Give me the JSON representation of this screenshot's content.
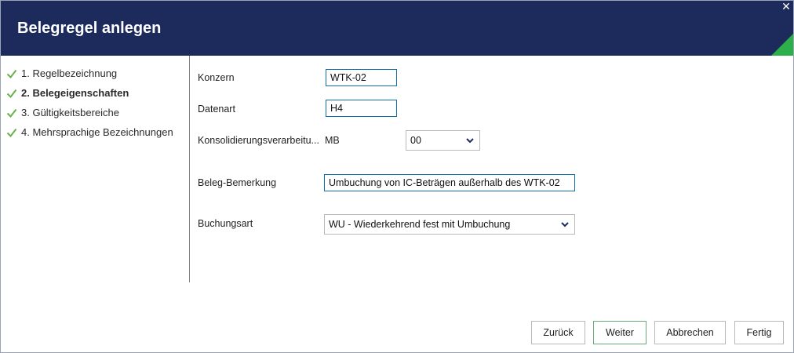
{
  "dialog": {
    "title": "Belegregel anlegen",
    "close_symbol": "✕"
  },
  "steps": [
    {
      "label": "1. Regelbezeichnung",
      "done": true,
      "active": false
    },
    {
      "label": "2. Belegeigenschaften",
      "done": true,
      "active": true
    },
    {
      "label": "3. Gültigkeitsbereiche",
      "done": true,
      "active": false
    },
    {
      "label": "4. Mehrsprachige Bezeichnungen",
      "done": true,
      "active": false
    }
  ],
  "form": {
    "konzern": {
      "label": "Konzern",
      "value": "WTK-02"
    },
    "datenart": {
      "label": "Datenart",
      "value": "H4"
    },
    "konsolidierung": {
      "label": "Konsolidierungsverarbeitu...",
      "prefix": "MB",
      "value": "00"
    },
    "bemerkung": {
      "label": "Beleg-Bemerkung",
      "value": "Umbuchung von IC-Beträgen außerhalb des WTK-02"
    },
    "buchungsart": {
      "label": "Buchungsart",
      "value": "WU - Wiederkehrend fest mit Umbuchung"
    }
  },
  "buttons": {
    "back": "Zurück",
    "next": "Weiter",
    "cancel": "Abbrechen",
    "finish": "Fertig"
  },
  "colors": {
    "header": "#1d2b5c",
    "accent_green": "#2bb04a",
    "input_border": "#0d6fa4",
    "check": "#6ab04c"
  }
}
